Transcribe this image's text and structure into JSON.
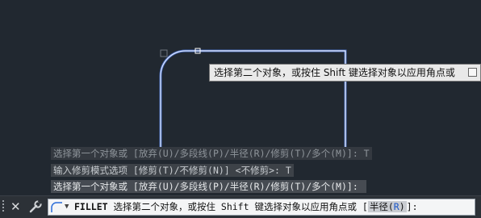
{
  "tooltip": {
    "text": "选择第二个对象，或按住 Shift 键选择对象以应用角点或"
  },
  "history": [
    "选择第一个对象或 [放弃(U)/多段线(P)/半径(R)/修剪(T)/多个(M)]: T",
    "输入修剪模式选项 [修剪(T)/不修剪(N)] <不修剪>: T",
    "选择第一个对象或 [放弃(U)/多段线(P)/半径(R)/修剪(T)/多个(M)]: "
  ],
  "command_line": {
    "command": "FILLET",
    "prompt": "选择第二个对象，或按住 Shift 键选择对象以应用角点或",
    "open_bracket": "[",
    "option_text": "半径(",
    "option_key": "R",
    "option_close": ")",
    "close_bracket": "]:"
  },
  "colors": {
    "background": "#212830",
    "geometry": "#ffffff",
    "highlight": "#5b8cff"
  }
}
